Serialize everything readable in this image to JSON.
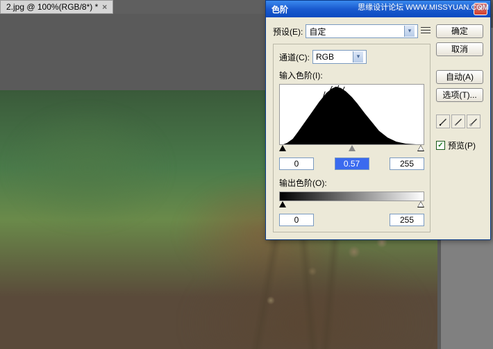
{
  "watermark": "思缘设计论坛 WWW.MISSYUAN.COM",
  "document": {
    "tab_label": "2.jpg @ 100%(RGB/8*) *",
    "close_glyph": "×"
  },
  "dialog": {
    "title": "色阶",
    "close_glyph": "×",
    "preset_label": "预设(E):",
    "preset_value": "自定",
    "channel_label": "通道(C):",
    "channel_value": "RGB",
    "input_levels_label": "输入色阶(I):",
    "input_black": "0",
    "input_gamma": "0.57",
    "input_white": "255",
    "output_levels_label": "输出色阶(O):",
    "output_black": "0",
    "output_white": "255",
    "buttons": {
      "ok": "确定",
      "cancel": "取消",
      "auto": "自动(A)",
      "options": "选项(T)..."
    },
    "preview_label": "预览(P)",
    "preview_checked": "✓"
  }
}
